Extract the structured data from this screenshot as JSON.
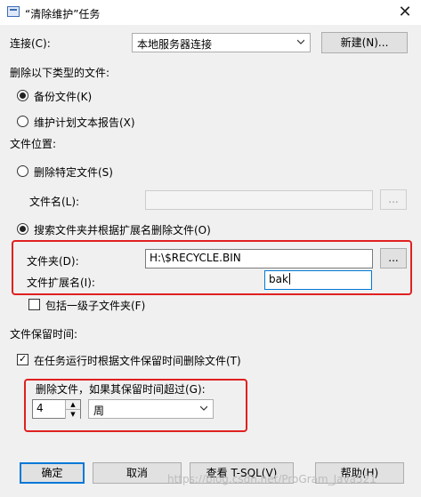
{
  "window": {
    "title": "“清除维护”任务",
    "close_symbol": "✕"
  },
  "connection": {
    "label": "连接(C):",
    "value": "本地服务器连接",
    "new_button": "新建(N)..."
  },
  "delete_type": {
    "heading": "删除以下类型的文件:",
    "options": [
      {
        "label": "备份文件(K)",
        "selected": true
      },
      {
        "label": "维护计划文本报告(X)",
        "selected": false
      }
    ]
  },
  "file_location": {
    "heading": "文件位置:",
    "specific_file": {
      "label": "删除特定文件(S)",
      "selected": false
    },
    "file_name": {
      "label": "文件名(L):",
      "value": "",
      "browse": "..."
    },
    "search_folder": {
      "label": "搜索文件夹并根据扩展名删除文件(O)",
      "selected": true
    },
    "folder": {
      "label": "文件夹(D):",
      "value": "H:\\$RECYCLE.BIN",
      "browse": "..."
    },
    "extension": {
      "label": "文件扩展名(I):",
      "value": "bak"
    },
    "include_subfolders": {
      "label": "包括一级子文件夹(F)",
      "checked": false
    }
  },
  "retention": {
    "heading": "文件保留时间:",
    "by_age": {
      "label": "在任务运行时根据文件保留时间删除文件(T)",
      "checked": true,
      "tick": "✓"
    },
    "older_than": {
      "label": "删除文件，如果其保留时间超过(G):",
      "amount": "4",
      "unit": "周"
    }
  },
  "buttons": {
    "ok": "确定",
    "cancel": "取消",
    "view_tsql": "查看 T-SQL(V)",
    "help": "帮助(H)"
  },
  "watermark": "https://blog.csdn.net/ProGram_Java521"
}
